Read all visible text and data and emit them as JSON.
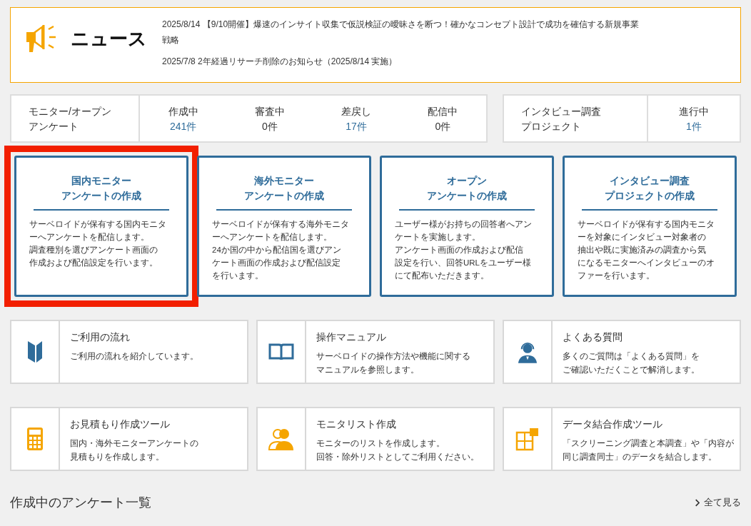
{
  "news": {
    "title": "ニュース",
    "items": [
      {
        "date": "2025/8/14",
        "text": "【9/10開催】爆速のインサイト収集で仮説検証の曖昧さを断つ！確かなコンセプト設計で成功を確信する新規事業戦略"
      },
      {
        "date": "2025/7/8",
        "text": "2年経過リサーチ削除のお知らせ（2025/8/14 実施）"
      }
    ]
  },
  "stats": [
    {
      "label_lines": [
        "モニター/オープン",
        "アンケート"
      ],
      "items": [
        {
          "label": "作成中",
          "count": "241件",
          "link": true
        },
        {
          "label": "審査中",
          "count": "0件",
          "link": false
        },
        {
          "label": "差戻し",
          "count": "17件",
          "link": true
        },
        {
          "label": "配信中",
          "count": "0件",
          "link": false
        }
      ]
    },
    {
      "label_lines": [
        "インタビュー調査",
        "プロジェクト"
      ],
      "items": [
        {
          "label": "進行中",
          "count": "1件",
          "link": true
        }
      ]
    }
  ],
  "create_cards": [
    {
      "title_lines": [
        "国内モニター",
        "アンケートの作成"
      ],
      "description_lines": [
        "サーベロイドが保有する国内モニタ",
        "ーへアンケートを配信します。",
        "調査種別を選びアンケート画面の",
        "作成および配信設定を行います。"
      ],
      "highlighted": true
    },
    {
      "title_lines": [
        "海外モニター",
        "アンケートの作成"
      ],
      "description_lines": [
        "サーベロイドが保有する海外モニタ",
        "ーへアンケートを配信します。",
        "24か国の中から配信国を選びアン",
        "ケート画面の作成および配信設定",
        "を行います。"
      ],
      "highlighted": false
    },
    {
      "title_lines": [
        "オープン",
        "アンケートの作成"
      ],
      "description_lines": [
        "ユーザー様がお持ちの回答者へアン",
        "ケートを実施します。",
        "アンケート画面の作成および配信",
        "設定を行い、回答URLをユーザー様",
        "にて配布いただきます。"
      ],
      "highlighted": false
    },
    {
      "title_lines": [
        "インタビュー調査",
        "プロジェクトの作成"
      ],
      "description_lines": [
        "サーベロイドが保有する国内モニタ",
        "ーを対象にインタビュー対象者の",
        "抽出や既に実施済みの調査から気",
        "になるモニターへインタビューのオ",
        "ファーを行います。"
      ],
      "highlighted": false
    }
  ],
  "links": [
    {
      "title": "ご利用の流れ",
      "description_lines": [
        "ご利用の流れを紹介しています。"
      ]
    },
    {
      "title": "操作マニュアル",
      "description_lines": [
        "サーベロイドの操作方法や機能に関する",
        "マニュアルを参照します。"
      ]
    },
    {
      "title": "よくある質問",
      "description_lines": [
        "多くのご質問は「よくある質問」を",
        "ご確認いただくことで解消します。"
      ]
    },
    {
      "title": "お見積もり作成ツール",
      "description_lines": [
        "国内・海外モニターアンケートの",
        "見積もりを作成します。"
      ]
    },
    {
      "title": "モニタリスト作成",
      "description_lines": [
        "モニターのリストを作成します。",
        "回答・除外リストとしてご利用ください。"
      ]
    },
    {
      "title": "データ結合作成ツール",
      "description_lines": [
        "「スクリーニング調査と本調査」や「内容が",
        "同じ調査同士」のデータを結合します。"
      ]
    }
  ],
  "section": {
    "title": "作成中のアンケート一覧",
    "link": "全て見る"
  }
}
